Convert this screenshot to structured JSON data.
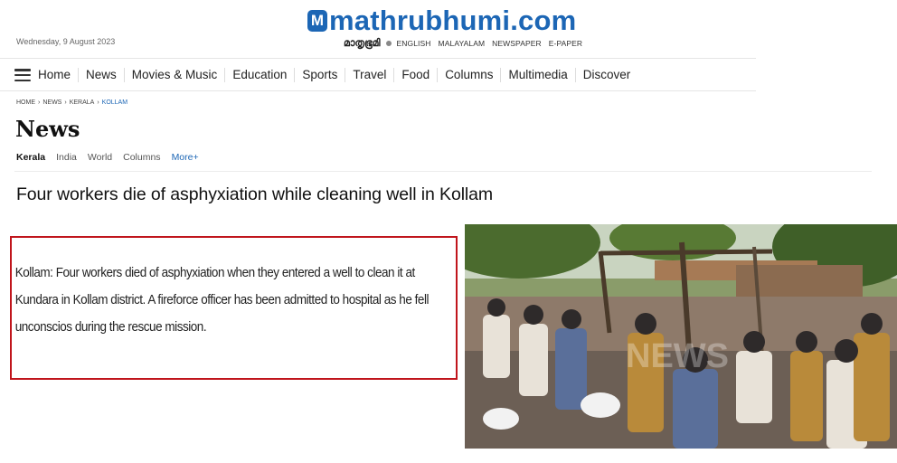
{
  "header": {
    "date": "Wednesday, 9 August 2023",
    "logo_letter": "M",
    "logo_text": "mathrubhumi.com",
    "malayalam_wordmark": "മാതൃഭൂമി",
    "links": [
      "ENGLISH",
      "MALAYALAM",
      "NEWSPAPER",
      "E-PAPER"
    ]
  },
  "nav": {
    "items": [
      "Home",
      "News",
      "Movies & Music",
      "Education",
      "Sports",
      "Travel",
      "Food",
      "Columns",
      "Multimedia",
      "Discover"
    ]
  },
  "breadcrumb": {
    "items": [
      "HOME",
      "NEWS",
      "KERALA"
    ],
    "current": "KOLLAM",
    "separator": "›"
  },
  "section": {
    "title": "News",
    "tabs": [
      "Kerala",
      "India",
      "World",
      "Columns"
    ],
    "more": "More+"
  },
  "article": {
    "headline": "Four workers die of asphyxiation while cleaning well in Kollam",
    "lead": "Kollam: Four workers died of asphyxiation when they entered a well to clean it at Kundara in Kollam district. A fireforce officer has been admitted to hospital as he fell unconscios during the rescue mission.",
    "photo_watermark": "NEWS",
    "highlight_color": "#c0151c"
  },
  "colors": {
    "brand_blue": "#1c66b5"
  }
}
